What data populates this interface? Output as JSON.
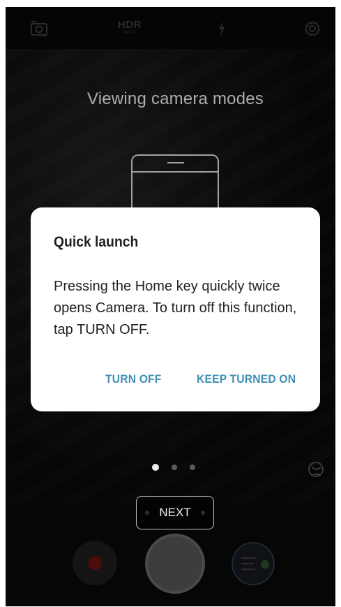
{
  "camera": {
    "top_bar": {
      "hdr_label": "HDR",
      "hdr_sub_label": "AUTO",
      "icons": [
        "switch-camera-icon",
        "hdr-icon",
        "flash-icon",
        "settings-icon"
      ]
    },
    "overlay": {
      "title": "Viewing camera modes"
    },
    "page_indicator": {
      "total": 3,
      "active_index": 0
    },
    "next_button": {
      "label": "NEXT"
    },
    "bottom_controls": [
      "record-button",
      "shutter-button",
      "gallery-thumbnail"
    ]
  },
  "dialog": {
    "title": "Quick launch",
    "body": "Pressing the Home key quickly twice opens Camera. To turn off this function, tap TURN OFF.",
    "buttons": {
      "turn_off": "TURN OFF",
      "keep_on": "KEEP TURNED ON"
    }
  },
  "colors": {
    "dialog_button": "#3f8fb5",
    "dialog_background": "#ffffff",
    "camera_background": "#050505"
  }
}
